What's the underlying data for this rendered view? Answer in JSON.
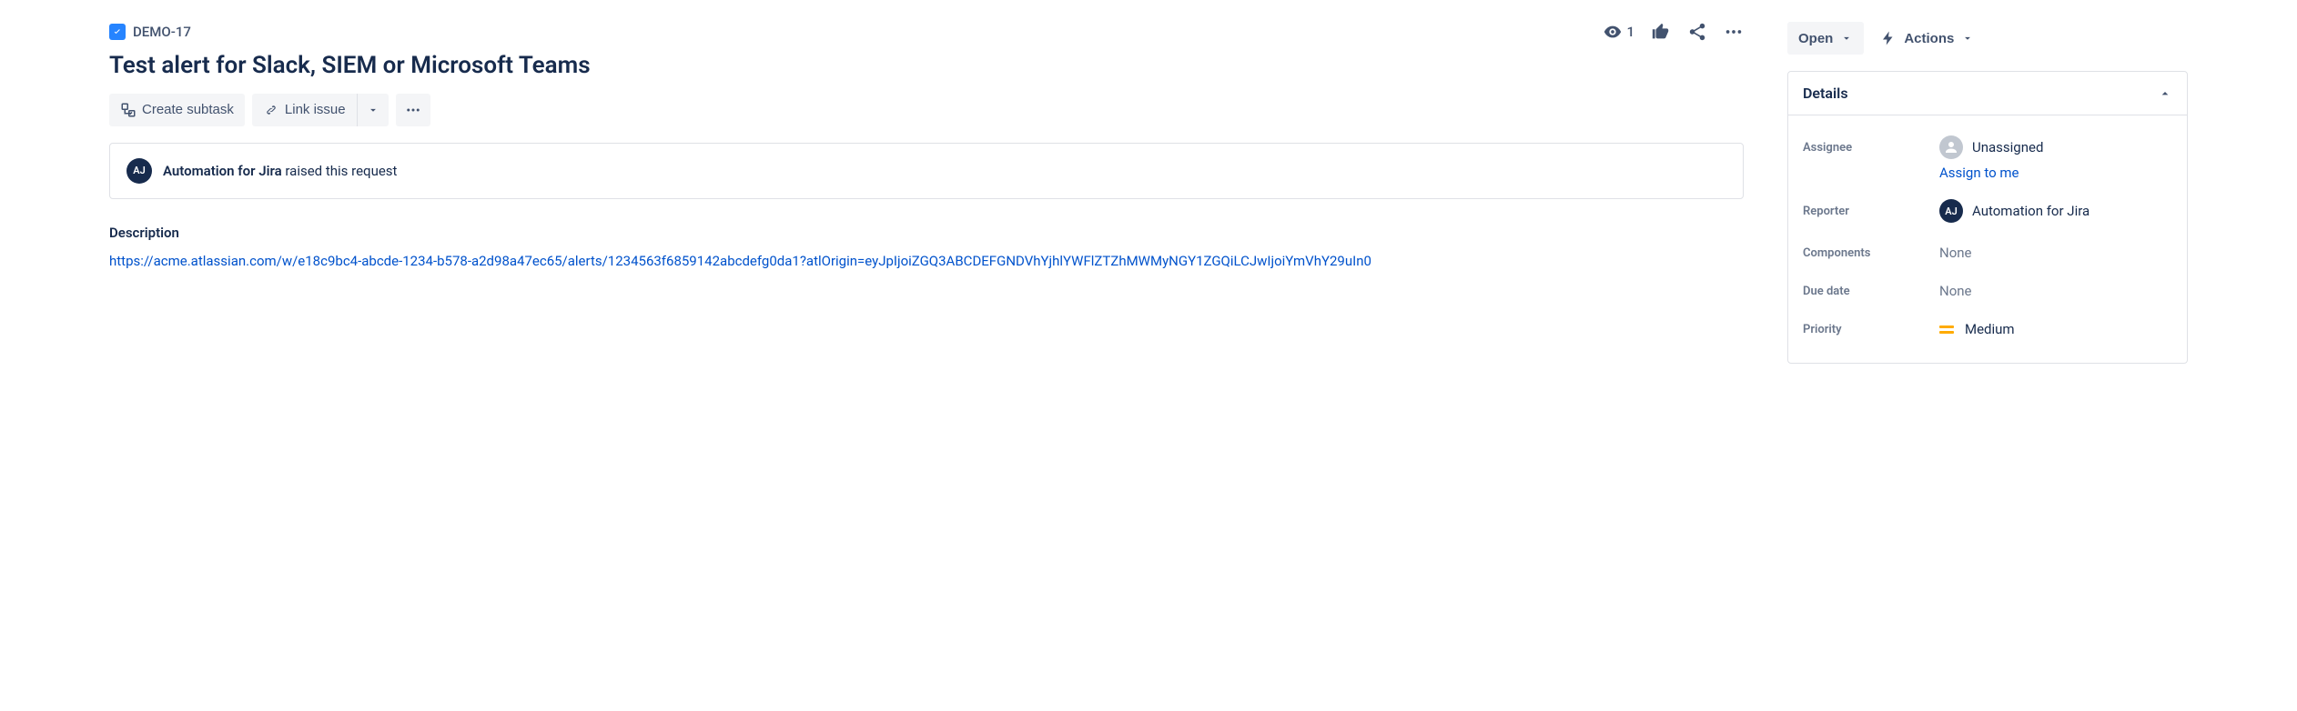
{
  "breadcrumb": {
    "issue_key": "DEMO-17"
  },
  "header": {
    "title": "Test alert for Slack, SIEM or Microsoft Teams",
    "watch_count": "1"
  },
  "toolbar": {
    "create_subtask": "Create subtask",
    "link_issue": "Link issue"
  },
  "request_box": {
    "author": "Automation for Jira",
    "suffix": " raised this request"
  },
  "description": {
    "heading": "Description",
    "url": "https://acme.atlassian.com/w/e18c9bc4-abcde-1234-b578-a2d98a47ec65/alerts/1234563f6859142abcdefg0da1?atlOrigin=eyJpIjoiZGQ3ABCDEFGNDVhYjhlYWFlZTZhMWMyNGY1ZGQiLCJwIjoiYmVhY29uIn0"
  },
  "status": {
    "label": "Open"
  },
  "actions": {
    "label": "Actions"
  },
  "details": {
    "title": "Details",
    "fields": {
      "assignee_label": "Assignee",
      "assignee_value": "Unassigned",
      "assign_to_me": "Assign to me",
      "reporter_label": "Reporter",
      "reporter_value": "Automation for Jira",
      "components_label": "Components",
      "components_value": "None",
      "due_label": "Due date",
      "due_value": "None",
      "priority_label": "Priority",
      "priority_value": "Medium"
    }
  }
}
